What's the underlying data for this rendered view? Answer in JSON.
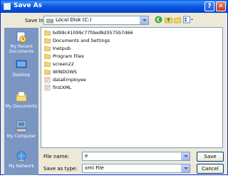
{
  "window": {
    "title": "Save As",
    "help_label": "?",
    "close_label": "✕"
  },
  "save_in": {
    "label": "Save in:",
    "value": "Local Disk (C:)"
  },
  "toolbar": {
    "icons": [
      "back-icon",
      "up-folder-icon",
      "new-folder-icon",
      "views-icon"
    ]
  },
  "places": [
    {
      "label": "My Recent Documents",
      "icon": "recent-documents-icon"
    },
    {
      "label": "Desktop",
      "icon": "desktop-icon"
    },
    {
      "label": "My Documents",
      "icon": "my-documents-icon"
    },
    {
      "label": "My Computer",
      "icon": "my-computer-icon"
    },
    {
      "label": "My Network",
      "icon": "my-network-icon"
    }
  ],
  "files": [
    {
      "name": "bd99c41099c77fded8d3575b7d66",
      "type": "folder"
    },
    {
      "name": "Documents and Settings",
      "type": "folder"
    },
    {
      "name": "Inetpub",
      "type": "folder"
    },
    {
      "name": "Program Files",
      "type": "folder"
    },
    {
      "name": "screen22",
      "type": "folder"
    },
    {
      "name": "WINDOWS",
      "type": "folder"
    },
    {
      "name": "dataEmployee",
      "type": "file"
    },
    {
      "name": "firstXML",
      "type": "file"
    }
  ],
  "file_name": {
    "label": "File name:",
    "value": "e"
  },
  "save_as_type": {
    "label": "Save as type:",
    "value": "xml File"
  },
  "buttons": {
    "save": "Save",
    "cancel": "Cancel"
  },
  "colors": {
    "title_bar": "#0a57e0",
    "places_bar": "#7b96c3",
    "dialog_bg": "#ece9d8",
    "folder": "#f4d36c"
  }
}
